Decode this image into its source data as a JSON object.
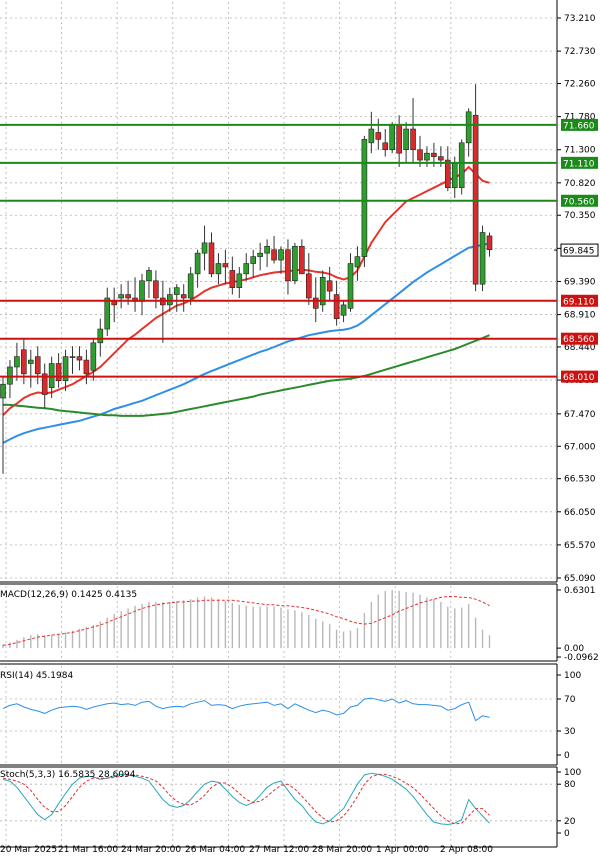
{
  "colors": {
    "bull": "#2e9e2e",
    "bear": "#d92b2b",
    "ma_fast": "#e8322a",
    "ma_mid": "#2f8fe8",
    "ma_slow": "#2b8a2b",
    "support": "#cc1111",
    "resistance": "#1b8a1b",
    "macd_hist": "#b8b8b8",
    "macd_signal": "#e83030",
    "rsi": "#2f8fe8",
    "stoch_k": "#2aa6b8",
    "stoch_d": "#e03030",
    "grid": "#b5b5b5",
    "current_price_box": "#000000"
  },
  "chart_data": [
    {
      "type": "candlestick",
      "panel": "price",
      "yticks": [
        "73.210",
        "72.730",
        "72.260",
        "71.780",
        "71.300",
        "70.820",
        "70.350",
        "69.870",
        "69.390",
        "68.910",
        "68.440",
        "67.960",
        "67.470",
        "67.000",
        "66.530",
        "66.050",
        "65.570",
        "65.090"
      ],
      "ylim": [
        65.09,
        73.21
      ],
      "xticks": [
        "20 Mar 2025",
        "21 Mar 16:00",
        "24 Mar 20:00",
        "26 Mar 04:00",
        "27 Mar 12:00",
        "28 Mar 20:00",
        "1 Apr 00:00",
        "2 Apr 08:00"
      ],
      "current_price": "69.845",
      "levels": [
        {
          "label": "71.660",
          "value": 71.66,
          "kind": "resistance"
        },
        {
          "label": "71.110",
          "value": 71.11,
          "kind": "resistance"
        },
        {
          "label": "70.560",
          "value": 70.56,
          "kind": "resistance"
        },
        {
          "label": "69.110",
          "value": 69.11,
          "kind": "support"
        },
        {
          "label": "68.560",
          "value": 68.56,
          "kind": "support"
        },
        {
          "label": "68.010",
          "value": 68.01,
          "kind": "support"
        }
      ],
      "candles": [
        [
          67.7,
          68.0,
          66.6,
          67.9
        ],
        [
          67.9,
          68.25,
          67.7,
          68.15
        ],
        [
          68.15,
          68.5,
          67.95,
          68.3
        ],
        [
          68.4,
          68.55,
          67.9,
          68.05
        ],
        [
          68.2,
          68.4,
          67.85,
          68.25
        ],
        [
          68.3,
          68.45,
          67.9,
          68.05
        ],
        [
          68.05,
          68.2,
          67.55,
          67.75
        ],
        [
          67.85,
          68.3,
          67.7,
          68.2
        ],
        [
          68.2,
          68.35,
          67.85,
          67.95
        ],
        [
          67.95,
          68.4,
          67.8,
          68.3
        ],
        [
          68.3,
          68.45,
          68.05,
          68.3
        ],
        [
          68.3,
          68.45,
          68.1,
          68.25
        ],
        [
          68.25,
          68.4,
          67.9,
          68.05
        ],
        [
          68.1,
          68.55,
          67.95,
          68.5
        ],
        [
          68.5,
          68.85,
          68.3,
          68.7
        ],
        [
          68.7,
          69.3,
          68.6,
          69.15
        ],
        [
          69.1,
          69.3,
          68.8,
          69.05
        ],
        [
          69.15,
          69.35,
          69.0,
          69.2
        ],
        [
          69.2,
          69.4,
          69.05,
          69.15
        ],
        [
          69.15,
          69.45,
          68.95,
          69.1
        ],
        [
          69.1,
          69.5,
          68.9,
          69.4
        ],
        [
          69.4,
          69.6,
          69.15,
          69.55
        ],
        [
          69.4,
          69.55,
          69.0,
          69.15
        ],
        [
          69.15,
          69.4,
          68.5,
          69.05
        ],
        [
          69.05,
          69.3,
          68.95,
          69.2
        ],
        [
          69.2,
          69.35,
          68.95,
          69.3
        ],
        [
          69.2,
          69.35,
          68.95,
          69.15
        ],
        [
          69.15,
          69.6,
          69.05,
          69.5
        ],
        [
          69.5,
          69.85,
          69.3,
          69.8
        ],
        [
          69.8,
          70.2,
          69.55,
          69.95
        ],
        [
          69.95,
          70.1,
          69.45,
          69.5
        ],
        [
          69.5,
          69.8,
          69.35,
          69.65
        ],
        [
          69.65,
          69.85,
          69.35,
          69.6
        ],
        [
          69.55,
          69.75,
          69.2,
          69.3
        ],
        [
          69.3,
          69.6,
          69.15,
          69.5
        ],
        [
          69.5,
          69.8,
          69.4,
          69.65
        ],
        [
          69.65,
          69.85,
          69.45,
          69.75
        ],
        [
          69.75,
          69.95,
          69.55,
          69.8
        ],
        [
          69.8,
          70.0,
          69.6,
          69.9
        ],
        [
          69.85,
          70.05,
          69.65,
          69.7
        ],
        [
          69.7,
          69.9,
          69.5,
          69.85
        ],
        [
          69.85,
          70.0,
          69.2,
          69.4
        ],
        [
          69.4,
          69.95,
          69.35,
          69.9
        ],
        [
          69.9,
          70.0,
          69.5,
          69.5
        ],
        [
          69.5,
          69.8,
          69.05,
          69.15
        ],
        [
          69.15,
          69.45,
          68.8,
          69.0
        ],
        [
          69.05,
          69.55,
          68.95,
          69.45
        ],
        [
          69.4,
          69.6,
          69.1,
          69.25
        ],
        [
          69.2,
          69.4,
          68.75,
          68.85
        ],
        [
          68.9,
          69.1,
          68.8,
          69.05
        ],
        [
          69.0,
          69.8,
          68.95,
          69.65
        ],
        [
          69.6,
          69.9,
          69.4,
          69.75
        ],
        [
          69.75,
          71.5,
          69.6,
          71.45
        ],
        [
          71.4,
          71.85,
          71.25,
          71.6
        ],
        [
          71.55,
          71.75,
          71.3,
          71.45
        ],
        [
          71.4,
          71.6,
          71.2,
          71.3
        ],
        [
          71.3,
          71.7,
          71.25,
          71.65
        ],
        [
          71.65,
          71.8,
          71.05,
          71.25
        ],
        [
          71.3,
          71.7,
          71.1,
          71.6
        ],
        [
          71.6,
          72.05,
          71.1,
          71.3
        ],
        [
          71.3,
          71.5,
          71.05,
          71.15
        ],
        [
          71.15,
          71.35,
          71.05,
          71.25
        ],
        [
          71.25,
          71.4,
          71.05,
          71.2
        ],
        [
          71.2,
          71.35,
          71.05,
          71.15
        ],
        [
          71.15,
          71.35,
          70.7,
          70.75
        ],
        [
          70.75,
          71.2,
          70.6,
          71.1
        ],
        [
          70.75,
          71.45,
          70.65,
          71.4
        ],
        [
          71.4,
          71.9,
          71.2,
          71.85
        ],
        [
          71.8,
          72.25,
          69.25,
          69.35
        ],
        [
          69.35,
          70.2,
          69.25,
          70.1
        ],
        [
          70.05,
          70.1,
          69.75,
          69.85
        ]
      ],
      "series": [
        {
          "values": [
            67.45,
            67.55,
            67.62,
            67.7,
            67.75,
            67.78,
            67.77,
            67.78,
            67.82,
            67.86,
            67.9,
            67.96,
            68.02,
            68.08,
            68.15,
            68.25,
            68.35,
            68.45,
            68.55,
            68.62,
            68.7,
            68.78,
            68.86,
            68.92,
            68.98,
            69.04,
            69.07,
            69.12,
            69.18,
            69.25,
            69.3,
            69.33,
            69.36,
            69.38,
            69.4,
            69.42,
            69.45,
            69.48,
            69.5,
            69.52,
            69.53,
            69.54,
            69.55,
            69.56,
            69.55,
            69.53,
            69.52,
            69.5,
            69.45,
            69.42,
            69.45,
            69.55,
            69.75,
            69.95,
            70.1,
            70.25,
            70.35,
            70.45,
            70.55,
            70.6,
            70.65,
            70.7,
            70.75,
            70.8,
            70.85,
            70.9,
            70.95,
            71.05,
            70.95,
            70.85,
            70.82
          ]
        },
        {
          "values": [
            67.05,
            67.1,
            67.15,
            67.19,
            67.22,
            67.25,
            67.27,
            67.29,
            67.31,
            67.33,
            67.35,
            67.37,
            67.4,
            67.43,
            67.46,
            67.5,
            67.54,
            67.57,
            67.6,
            67.63,
            67.66,
            67.7,
            67.74,
            67.78,
            67.82,
            67.86,
            67.9,
            67.95,
            68.0,
            68.05,
            68.09,
            68.13,
            68.17,
            68.21,
            68.25,
            68.29,
            68.33,
            68.37,
            68.4,
            68.44,
            68.48,
            68.52,
            68.55,
            68.58,
            68.61,
            68.63,
            68.65,
            68.67,
            68.68,
            68.69,
            68.71,
            68.75,
            68.82,
            68.9,
            68.98,
            69.06,
            69.14,
            69.22,
            69.3,
            69.38,
            69.45,
            69.52,
            69.58,
            69.64,
            69.7,
            69.76,
            69.82,
            69.88,
            69.9,
            69.92,
            69.94
          ]
        },
        {
          "values": [
            67.6,
            67.6,
            67.59,
            67.58,
            67.57,
            67.56,
            67.55,
            67.54,
            67.52,
            67.51,
            67.5,
            67.49,
            67.48,
            67.47,
            67.46,
            67.45,
            67.45,
            67.44,
            67.44,
            67.44,
            67.44,
            67.45,
            67.46,
            67.47,
            67.48,
            67.5,
            67.52,
            67.54,
            67.56,
            67.58,
            67.6,
            67.62,
            67.64,
            67.66,
            67.68,
            67.7,
            67.72,
            67.75,
            67.77,
            67.79,
            67.81,
            67.83,
            67.85,
            67.87,
            67.89,
            67.91,
            67.93,
            67.95,
            67.96,
            67.97,
            67.98,
            68.0,
            68.02,
            68.05,
            68.08,
            68.11,
            68.14,
            68.17,
            68.2,
            68.23,
            68.26,
            68.29,
            68.32,
            68.35,
            68.38,
            68.41,
            68.45,
            68.49,
            68.53,
            68.57,
            68.61
          ]
        }
      ]
    },
    {
      "type": "bar",
      "panel": "macd",
      "label": "MACD(12,26,9) 0.1425 0.4135",
      "yticks": [
        "0.6301",
        "0.00",
        "-0.0962"
      ],
      "ylim": [
        -0.0962,
        0.6301
      ],
      "values": [
        0.04,
        0.06,
        0.09,
        0.12,
        0.14,
        0.15,
        0.14,
        0.14,
        0.15,
        0.17,
        0.19,
        0.21,
        0.23,
        0.25,
        0.29,
        0.33,
        0.37,
        0.4,
        0.43,
        0.46,
        0.48,
        0.5,
        0.5,
        0.5,
        0.5,
        0.51,
        0.52,
        0.53,
        0.55,
        0.56,
        0.55,
        0.53,
        0.51,
        0.49,
        0.47,
        0.46,
        0.45,
        0.45,
        0.45,
        0.45,
        0.44,
        0.42,
        0.41,
        0.39,
        0.36,
        0.32,
        0.29,
        0.26,
        0.2,
        0.18,
        0.19,
        0.22,
        0.38,
        0.5,
        0.58,
        0.62,
        0.63,
        0.62,
        0.61,
        0.6,
        0.58,
        0.55,
        0.53,
        0.5,
        0.45,
        0.43,
        0.44,
        0.48,
        0.33,
        0.2,
        0.14
      ],
      "series": [
        {
          "values": [
            0.03,
            0.04,
            0.06,
            0.08,
            0.1,
            0.12,
            0.13,
            0.14,
            0.15,
            0.16,
            0.17,
            0.19,
            0.21,
            0.23,
            0.25,
            0.28,
            0.31,
            0.34,
            0.37,
            0.4,
            0.43,
            0.45,
            0.47,
            0.48,
            0.49,
            0.5,
            0.5,
            0.51,
            0.51,
            0.52,
            0.52,
            0.52,
            0.52,
            0.52,
            0.51,
            0.5,
            0.49,
            0.48,
            0.47,
            0.47,
            0.46,
            0.46,
            0.45,
            0.44,
            0.43,
            0.41,
            0.39,
            0.37,
            0.34,
            0.32,
            0.29,
            0.27,
            0.26,
            0.27,
            0.3,
            0.33,
            0.36,
            0.4,
            0.43,
            0.46,
            0.49,
            0.51,
            0.53,
            0.55,
            0.56,
            0.56,
            0.55,
            0.55,
            0.53,
            0.5,
            0.46
          ]
        }
      ]
    },
    {
      "type": "line",
      "panel": "rsi",
      "label": "RSI(14) 45.1984",
      "yticks": [
        "100",
        "70",
        "30",
        "0"
      ],
      "ylim": [
        0,
        100
      ],
      "series": [
        {
          "values": [
            58,
            62,
            64,
            60,
            57,
            55,
            52,
            56,
            59,
            60,
            61,
            60,
            57,
            60,
            62,
            64,
            65,
            63,
            64,
            62,
            66,
            67,
            61,
            58,
            60,
            61,
            60,
            64,
            66,
            68,
            62,
            63,
            62,
            58,
            61,
            63,
            64,
            65,
            66,
            62,
            64,
            58,
            64,
            60,
            56,
            53,
            56,
            54,
            50,
            52,
            60,
            62,
            70,
            71,
            69,
            67,
            70,
            65,
            68,
            64,
            63,
            63,
            62,
            61,
            56,
            58,
            63,
            66,
            43,
            49,
            47
          ]
        }
      ]
    },
    {
      "type": "line",
      "panel": "stochastic",
      "label": "Stoch(5,3,3) 16.5835 28.6094",
      "yticks": [
        "100",
        "80",
        "20",
        "0"
      ],
      "ylim": [
        0,
        100
      ],
      "series": [
        {
          "values": [
            88,
            85,
            75,
            60,
            45,
            30,
            22,
            30,
            48,
            65,
            80,
            90,
            93,
            92,
            88,
            90,
            94,
            96,
            95,
            93,
            90,
            85,
            70,
            55,
            45,
            42,
            45,
            55,
            68,
            80,
            85,
            83,
            72,
            60,
            50,
            45,
            50,
            62,
            75,
            82,
            85,
            70,
            55,
            45,
            30,
            18,
            15,
            20,
            30,
            40,
            60,
            80,
            95,
            98,
            96,
            93,
            88,
            80,
            72,
            60,
            45,
            30,
            18,
            15,
            14,
            16,
            22,
            55,
            40,
            28,
            16
          ]
        },
        {
          "values": [
            90,
            88,
            85,
            80,
            70,
            55,
            42,
            35,
            35,
            45,
            60,
            75,
            85,
            90,
            90,
            90,
            91,
            93,
            95,
            95,
            93,
            90,
            85,
            75,
            62,
            52,
            47,
            46,
            52,
            62,
            75,
            82,
            82,
            75,
            65,
            55,
            50,
            52,
            60,
            70,
            78,
            80,
            72,
            60,
            48,
            35,
            25,
            18,
            20,
            28,
            42,
            60,
            80,
            92,
            96,
            96,
            93,
            88,
            82,
            74,
            64,
            52,
            40,
            28,
            20,
            15,
            16,
            28,
            40,
            40,
            29
          ]
        }
      ]
    }
  ]
}
